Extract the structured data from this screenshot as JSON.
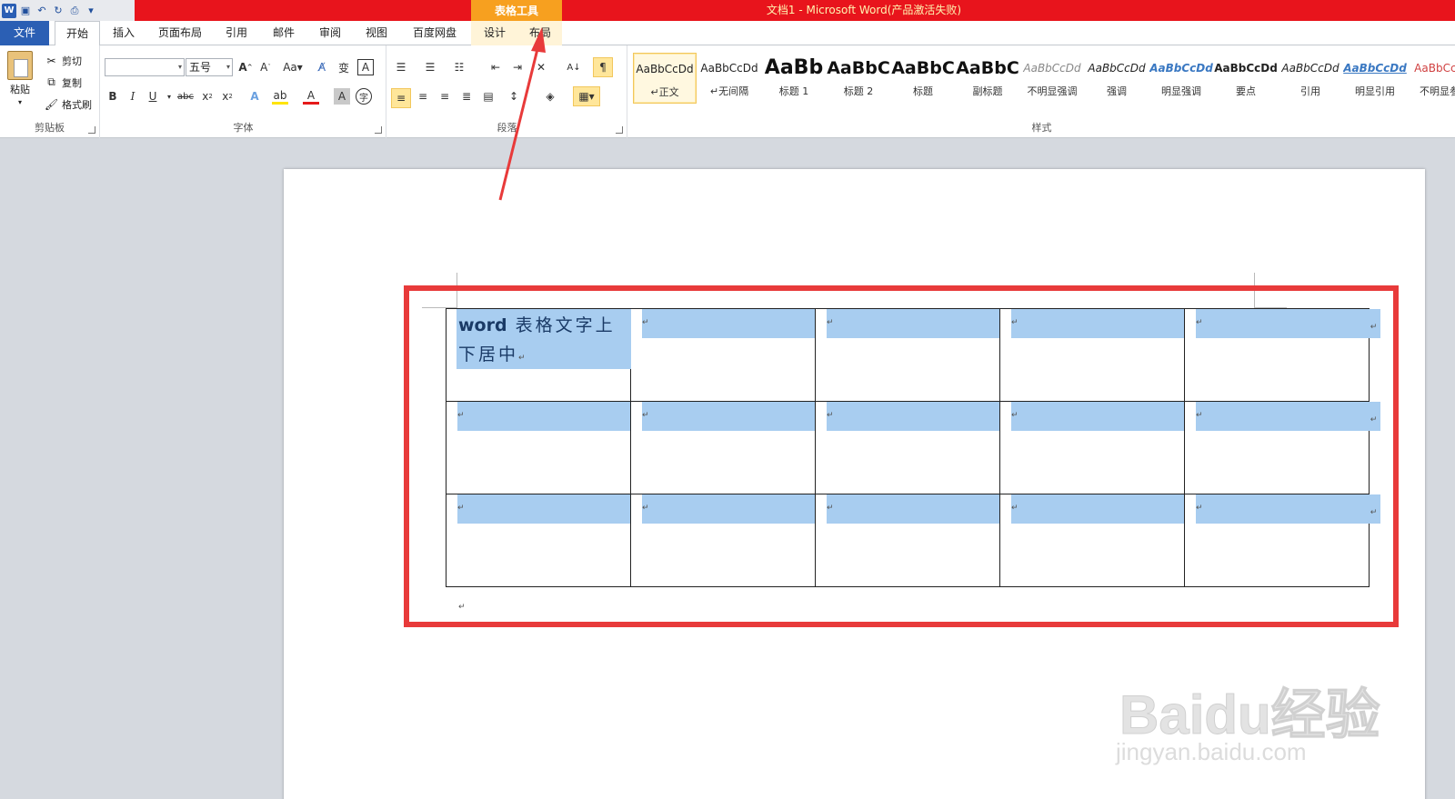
{
  "window": {
    "title": "文档1 - Microsoft Word(产品激活失败)",
    "context_tool_group": "表格工具"
  },
  "quick_access": {
    "icons": [
      "word-logo",
      "save-icon",
      "undo-icon",
      "redo-icon",
      "customize-icon"
    ]
  },
  "tabs": {
    "file": "文件",
    "home": "开始",
    "insert": "插入",
    "page_layout": "页面布局",
    "references": "引用",
    "mailings": "邮件",
    "review": "审阅",
    "view": "视图",
    "baidu_netdisk": "百度网盘",
    "design": "设计",
    "layout": "布局"
  },
  "ribbon": {
    "clipboard": {
      "group_label": "剪贴板",
      "paste": "粘贴",
      "cut": "剪切",
      "copy": "复制",
      "format_painter": "格式刷"
    },
    "font": {
      "group_label": "字体",
      "font_name": "",
      "font_size": "五号"
    },
    "paragraph": {
      "group_label": "段落"
    },
    "styles": {
      "group_label": "样式",
      "items": [
        {
          "sample": "AaBbCcDd",
          "name": "↵正文"
        },
        {
          "sample": "AaBbCcDd",
          "name": "↵无间隔"
        },
        {
          "sample": "AaBb",
          "name": "标题 1"
        },
        {
          "sample": "AaBbC",
          "name": "标题 2"
        },
        {
          "sample": "AaBbC",
          "name": "标题"
        },
        {
          "sample": "AaBbC",
          "name": "副标题"
        },
        {
          "sample": "AaBbCcDd",
          "name": "不明显强调"
        },
        {
          "sample": "AaBbCcDd",
          "name": "强调"
        },
        {
          "sample": "AaBbCcDd",
          "name": "明显强调"
        },
        {
          "sample": "AaBbCcDd",
          "name": "要点"
        },
        {
          "sample": "AaBbCcDd",
          "name": "引用"
        },
        {
          "sample": "AaBbCcDd",
          "name": "明显引用"
        },
        {
          "sample": "AaBbCcD",
          "name": "不明显参"
        }
      ]
    }
  },
  "document": {
    "first_cell_text_en": "word",
    "first_cell_text_cn": "表格文字上下居中",
    "cell_mark": "↵",
    "rows": 3,
    "cols": 5
  },
  "watermark": {
    "brand": "Baidu经验",
    "url": "jingyan.baidu.com"
  },
  "colors": {
    "title_red": "#e8141c",
    "context_orange": "#f7a01f",
    "file_tab_blue": "#2b5fb4",
    "selection": "#a8cdf0",
    "annotation_red": "#e83a3a"
  }
}
